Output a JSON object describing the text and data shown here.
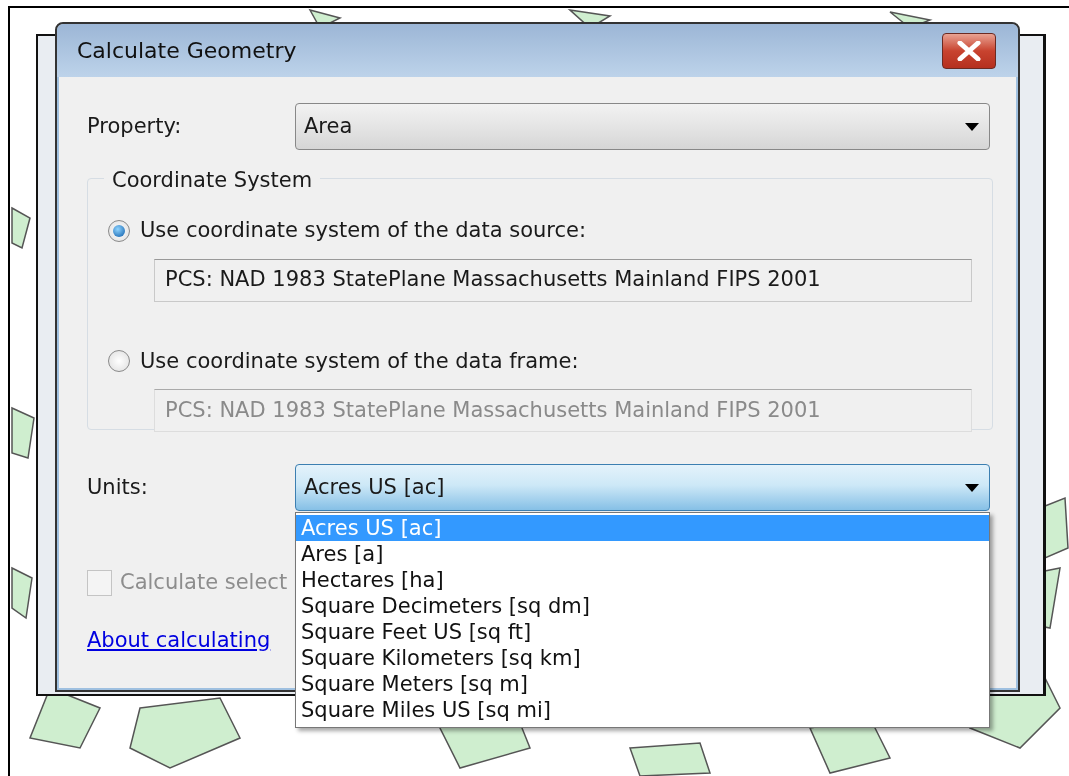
{
  "window": {
    "title": "Calculate Geometry"
  },
  "property": {
    "label": "Property:",
    "value": "Area"
  },
  "coordinate_system": {
    "title": "Coordinate System",
    "options": [
      {
        "label": "Use coordinate system of the data source:",
        "selected": true,
        "value": "PCS: NAD 1983 StatePlane Massachusetts Mainland FIPS 2001",
        "disabled": false
      },
      {
        "label": "Use coordinate system of the data frame:",
        "selected": false,
        "value": "PCS: NAD 1983 StatePlane Massachusetts Mainland FIPS 2001",
        "disabled": true
      }
    ]
  },
  "units": {
    "label": "Units:",
    "value": "Acres US [ac]",
    "expanded": true,
    "options": [
      {
        "label": "Acres US [ac]",
        "selected": true
      },
      {
        "label": "Ares [a]",
        "selected": false
      },
      {
        "label": "Hectares [ha]",
        "selected": false
      },
      {
        "label": "Square Decimeters [sq dm]",
        "selected": false
      },
      {
        "label": "Square Feet US [sq ft]",
        "selected": false
      },
      {
        "label": "Square Kilometers [sq km]",
        "selected": false
      },
      {
        "label": "Square Meters [sq m]",
        "selected": false
      },
      {
        "label": "Square Miles US [sq mi]",
        "selected": false
      }
    ]
  },
  "calculate_selected": {
    "label": "Calculate select",
    "checked": false,
    "disabled": true
  },
  "help_link": {
    "label": "About calculating"
  }
}
